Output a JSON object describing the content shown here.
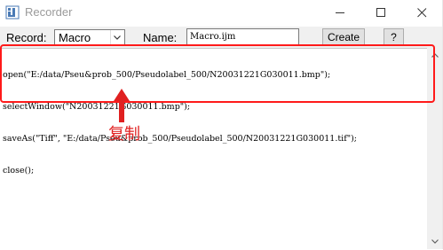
{
  "window": {
    "title": "Recorder",
    "icon": "imagej-icon"
  },
  "toolbar": {
    "record_label": "Record:",
    "record_mode": "Macro",
    "name_label": "Name:",
    "name_value": "Macro.ijm",
    "create_label": "Create",
    "help_label": "?"
  },
  "editor": {
    "lines": [
      "open(\"E:/data/Pseu&prob_500/Pseudolabel_500/N20031221G030011.bmp\");",
      "selectWindow(\"N20031221G030011.bmp\");",
      "saveAs(\"Tiff\", \"E:/data/Pseu&prob_500/Pseudolabel_500/N20031221G030011.tif\");",
      "close();"
    ]
  },
  "annotation": {
    "text": "复制",
    "color": "#e02020"
  }
}
